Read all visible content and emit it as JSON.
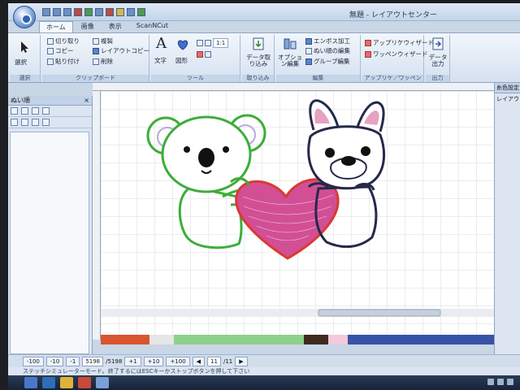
{
  "window": {
    "title": "無題 - レイアウトセンター"
  },
  "tabs": [
    {
      "label": "ホーム",
      "active": true
    },
    {
      "label": "画像",
      "active": false
    },
    {
      "label": "表示",
      "active": false
    },
    {
      "label": "ScanNCut",
      "active": false
    }
  ],
  "ribbon": {
    "select": {
      "label": "選択",
      "group": "選択"
    },
    "clipboard": {
      "group": "クリップボード",
      "cut": "切り取り",
      "copy": "コピー",
      "paste": "貼り付け",
      "duplicate": "複製",
      "layout_copy": "レイアウトコピー",
      "delete": "削除"
    },
    "tools": {
      "group": "ツール",
      "text": "文字",
      "shape": "図形",
      "zoom_value": "1:1"
    },
    "import": {
      "group": "取り込み",
      "label": "データ取り込み"
    },
    "edit": {
      "group": "編集",
      "option": "オプション編集",
      "emboss": "エンボス加工",
      "sew_order": "ぬい順の編集",
      "group_edit": "グループ編集"
    },
    "applique": {
      "group": "アップリケ／ワッペン",
      "applique_wizard": "アップリケウィザード",
      "patch_wizard": "ワッペンウィザード"
    },
    "output": {
      "group": "出力",
      "label": "データ出力"
    }
  },
  "left_panel": {
    "title": "ぬい順",
    "close": "×"
  },
  "right_panel": {
    "title": "糸色設定",
    "item": "レイアウト"
  },
  "design": {
    "koala_color": "#3dad3a",
    "koala_inner_color": "#b8a9d8",
    "heart_color": "#d93a33",
    "heart_fill_color": "#d24f95",
    "dog_color": "#26284a",
    "dog_ear_color": "#e6a2c1",
    "eye_color": "#111111"
  },
  "color_bar": [
    {
      "color": "#d7562e",
      "width": 60
    },
    {
      "color": "#e6e6e6",
      "width": 30
    },
    {
      "color": "#8fd08a",
      "width": 160
    },
    {
      "color": "#3e2b1e",
      "width": 30
    },
    {
      "color": "#f3c9dc",
      "width": 24
    },
    {
      "color": "#3653a8",
      "width": 180
    }
  ],
  "bottom_bar": {
    "b1": "-100",
    "b2": "-10",
    "b3": "-1",
    "stitch": "5198",
    "stitch_total": "/5198",
    "b4": "+1",
    "b5": "+10",
    "b6": "+100",
    "color_index": "11",
    "color_total": "/11"
  },
  "status": "ステッチシミュレーターモード。終了するにはESCキーかストップボタンを押して下さい"
}
